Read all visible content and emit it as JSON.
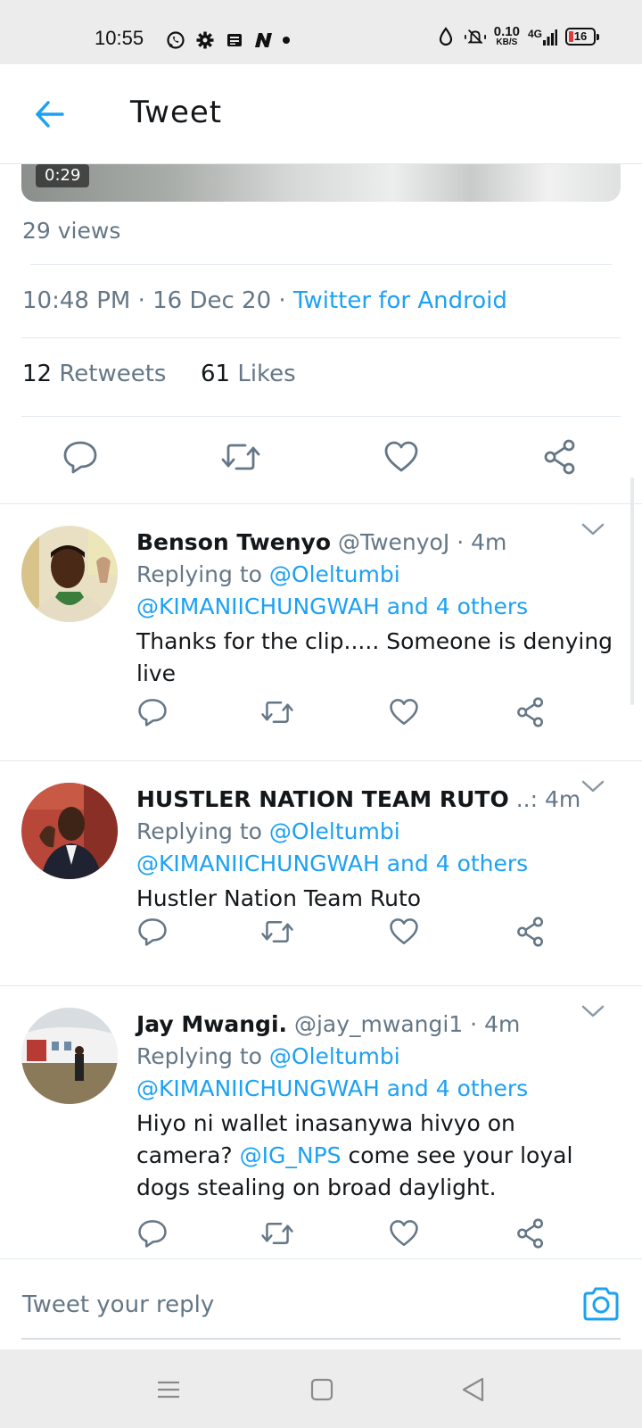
{
  "status_bar": {
    "time": "10:55",
    "speed_value": "0.10",
    "speed_unit": "KB/S",
    "network": "4G",
    "battery": "16",
    "battery_color": "#e0393e"
  },
  "header": {
    "back_icon": "arrow-left-icon",
    "title": "Tweet",
    "accent": "#1da1f2"
  },
  "media": {
    "duration": "0:29"
  },
  "tweet": {
    "views": "29 views",
    "time": "10:48 PM",
    "date": "16 Dec 20",
    "sep": " · ",
    "source": "Twitter for Android",
    "retweets_count": "12",
    "retweets_label": "Retweets",
    "likes_count": "61",
    "likes_label": "Likes",
    "actions": [
      "reply-icon",
      "retweet-icon",
      "like-icon",
      "share-icon"
    ]
  },
  "replies": [
    {
      "name": "Benson Twenyo",
      "handle": "@TwenyoJ",
      "time": "4m",
      "replying_label": "Replying to",
      "replying_user": "@Oleltumbi",
      "replying_line2_user": "@KIMANIICHUNGWAH",
      "replying_line2_rest": "and 4 others",
      "text": "Thanks for the clip..... Someone is denying  live"
    },
    {
      "name": "HUSTLER NATION TEAM RUTO",
      "name_ellipsis": "..:",
      "time": "4m",
      "replying_label": "Replying to",
      "replying_user": "@Oleltumbi",
      "replying_line2_user": "@KIMANIICHUNGWAH",
      "replying_line2_rest": "and 4 others",
      "text": "Hustler Nation Team Ruto"
    },
    {
      "name": "Jay Mwangi.",
      "handle": "@jay_mwangi1",
      "time": "4m",
      "replying_label": "Replying to",
      "replying_user": "@Oleltumbi",
      "replying_line2_user": "@KIMANIICHUNGWAH",
      "replying_line2_rest": "and 4 others",
      "text_part1": "Hiyo ni wallet inasanywa hivyo on camera? ",
      "text_mention": "@IG_NPS",
      "text_part2": " come see your loyal dogs stealing on broad daylight."
    }
  ],
  "composer": {
    "placeholder": "Tweet your reply",
    "camera_icon": "camera-icon"
  },
  "nav": [
    "menu-icon",
    "home-square-icon",
    "back-triangle-icon"
  ]
}
